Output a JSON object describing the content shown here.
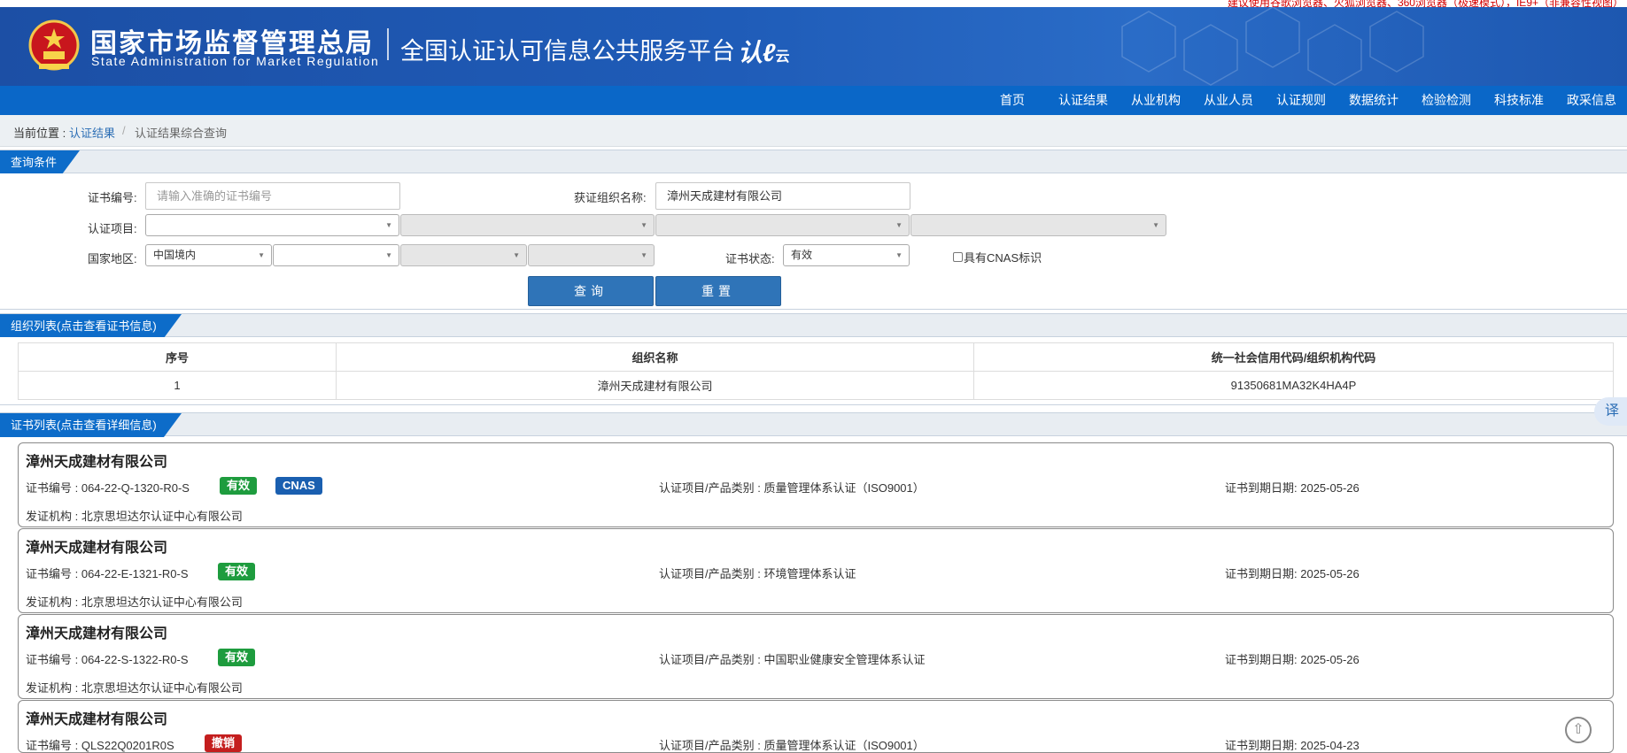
{
  "top_notice": "建议使用谷歌浏览器、火狐浏览器、360浏览器（极速模式），IE9+（非兼容性视图）",
  "header": {
    "agency_cn": "国家市场监督管理总局",
    "agency_en": "State Administration  for  Market Regulation",
    "platform": "全国认证认可信息公共服务平台",
    "logo_text": "认",
    "logo_suffix": "云"
  },
  "nav": [
    "首页",
    "认证结果",
    "从业机构",
    "从业人员",
    "认证规则",
    "数据统计",
    "检验检测",
    "科技标准",
    "政采信息"
  ],
  "breadcrumb": {
    "label": "当前位置 :",
    "link": "认证结果",
    "sep": "/",
    "current": "认证结果综合查询"
  },
  "query": {
    "title": "查询条件",
    "cert_no_label": "证书编号:",
    "cert_no_placeholder": "请输入准确的证书编号",
    "org_name_label": "获证组织名称:",
    "org_name_value": "漳州天成建材有限公司",
    "cert_item_label": "认证项目:",
    "region_label": "国家地区:",
    "region_value": "中国境内",
    "status_label": "证书状态:",
    "status_value": "有效",
    "cnas_label": "具有CNAS标识",
    "search_btn": "查询",
    "reset_btn": "重置"
  },
  "org_list": {
    "title": "组织列表(点击查看证书信息)",
    "headers": [
      "序号",
      "组织名称",
      "统一社会信用代码/组织机构代码"
    ],
    "rows": [
      [
        "1",
        "漳州天成建材有限公司",
        "91350681MA32K4HA4P"
      ]
    ]
  },
  "cert_list": {
    "title": "证书列表(点击查看详细信息)",
    "no_prefix": "证书编号 : ",
    "item_prefix": "认证项目/产品类别 : ",
    "expiry_prefix": "证书到期日期:  ",
    "issuer_prefix": "发证机构 : ",
    "cards": [
      {
        "org": "漳州天成建材有限公司",
        "cert_no": "064-22-Q-1320-R0-S",
        "status": "有效",
        "cnas": "CNAS",
        "item": "质量管理体系认证（ISO9001）",
        "expiry": "2025-05-26",
        "issuer": "北京思坦达尔认证中心有限公司"
      },
      {
        "org": "漳州天成建材有限公司",
        "cert_no": "064-22-E-1321-R0-S",
        "status": "有效",
        "cnas": "",
        "item": "环境管理体系认证",
        "expiry": "2025-05-26",
        "issuer": "北京思坦达尔认证中心有限公司"
      },
      {
        "org": "漳州天成建材有限公司",
        "cert_no": "064-22-S-1322-R0-S",
        "status": "有效",
        "cnas": "",
        "item": "中国职业健康安全管理体系认证",
        "expiry": "2025-05-26",
        "issuer": "北京思坦达尔认证中心有限公司"
      },
      {
        "org": "漳州天成建材有限公司",
        "cert_no": "QLS22Q0201R0S",
        "status": "撤销",
        "cnas": "",
        "item": "质量管理体系认证（ISO9001）",
        "expiry": "2025-04-23",
        "issuer": ""
      }
    ]
  },
  "floating": {
    "translate": "译",
    "to_top": "⇧"
  },
  "colors": {
    "nav_blue": "#0a67c8",
    "header_blue": "#1f5cb8",
    "valid_green": "#1e9c3e",
    "cnas_blue": "#1a5fb0",
    "revoked_red": "#c41e1e"
  }
}
